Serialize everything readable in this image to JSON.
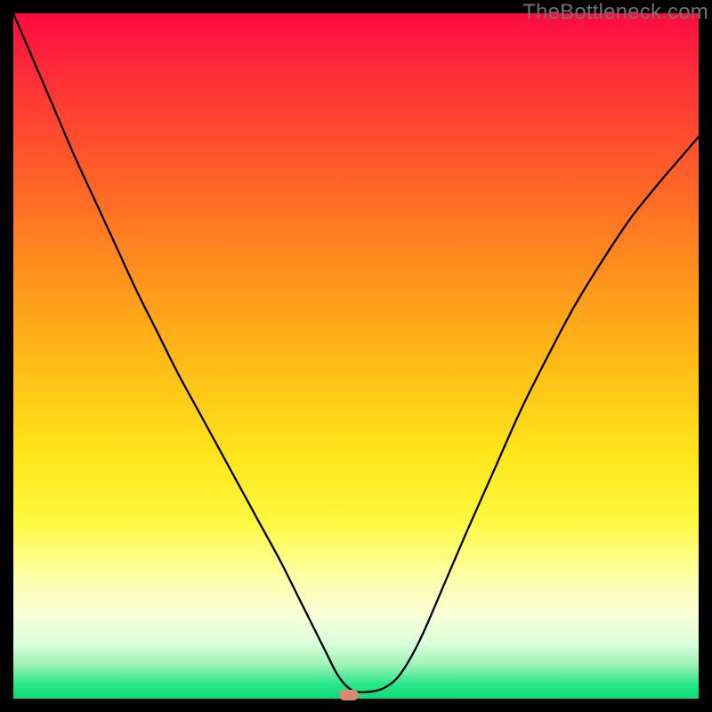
{
  "watermark": "TheBottleneck.com",
  "marker_color": "#d88a75",
  "chart_data": {
    "type": "line",
    "title": "",
    "xlabel": "",
    "ylabel": "",
    "xlim": [
      0,
      100
    ],
    "ylim": [
      0,
      100
    ],
    "x": [
      0,
      3,
      6,
      9,
      12,
      15,
      18,
      21,
      24,
      27,
      30,
      33,
      36,
      39,
      42,
      44,
      46,
      47,
      48,
      49,
      50,
      52,
      54,
      56,
      58,
      60,
      63,
      66,
      70,
      74,
      78,
      82,
      86,
      90,
      94,
      97,
      100
    ],
    "values": [
      100,
      93,
      86,
      79,
      72.5,
      66,
      59.5,
      53.5,
      47.5,
      42,
      36.5,
      31,
      25.5,
      20,
      14,
      10,
      6,
      4,
      2.5,
      1.5,
      1,
      1,
      1.5,
      3,
      6,
      10,
      17,
      24,
      33,
      42,
      50,
      57.5,
      64,
      70,
      75,
      78.5,
      82
    ],
    "minimum": {
      "x": 49,
      "y": 0.5
    },
    "grid": false,
    "legend": false
  }
}
